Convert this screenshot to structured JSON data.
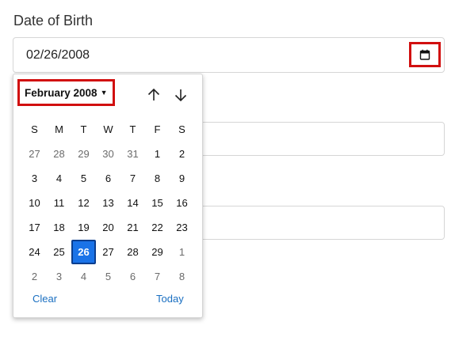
{
  "field": {
    "label": "Date of Birth",
    "value": "02/26/2008"
  },
  "icons": {
    "calendar": "calendar-icon",
    "up": "arrow-up-icon",
    "down": "arrow-down-icon",
    "caret": "caret-down-icon"
  },
  "calendar": {
    "month_label": "February 2008",
    "weekdays": [
      "S",
      "M",
      "T",
      "W",
      "T",
      "F",
      "S"
    ],
    "weeks": [
      [
        {
          "d": "27",
          "o": true
        },
        {
          "d": "28",
          "o": true
        },
        {
          "d": "29",
          "o": true
        },
        {
          "d": "30",
          "o": true
        },
        {
          "d": "31",
          "o": true
        },
        {
          "d": "1"
        },
        {
          "d": "2"
        }
      ],
      [
        {
          "d": "3"
        },
        {
          "d": "4"
        },
        {
          "d": "5"
        },
        {
          "d": "6"
        },
        {
          "d": "7"
        },
        {
          "d": "8"
        },
        {
          "d": "9"
        }
      ],
      [
        {
          "d": "10"
        },
        {
          "d": "11"
        },
        {
          "d": "12"
        },
        {
          "d": "13"
        },
        {
          "d": "14"
        },
        {
          "d": "15"
        },
        {
          "d": "16"
        }
      ],
      [
        {
          "d": "17"
        },
        {
          "d": "18"
        },
        {
          "d": "19"
        },
        {
          "d": "20"
        },
        {
          "d": "21"
        },
        {
          "d": "22"
        },
        {
          "d": "23"
        }
      ],
      [
        {
          "d": "24"
        },
        {
          "d": "25"
        },
        {
          "d": "26",
          "s": true
        },
        {
          "d": "27"
        },
        {
          "d": "28"
        },
        {
          "d": "29"
        },
        {
          "d": "1",
          "o": true
        }
      ],
      [
        {
          "d": "2",
          "o": true
        },
        {
          "d": "3",
          "o": true
        },
        {
          "d": "4",
          "o": true
        },
        {
          "d": "5",
          "o": true
        },
        {
          "d": "6",
          "o": true
        },
        {
          "d": "7",
          "o": true
        },
        {
          "d": "8",
          "o": true
        }
      ]
    ],
    "clear_label": "Clear",
    "today_label": "Today"
  },
  "colors": {
    "accent": "#1a73e8",
    "link": "#1a6fc1",
    "highlight": "#d10f0f"
  }
}
